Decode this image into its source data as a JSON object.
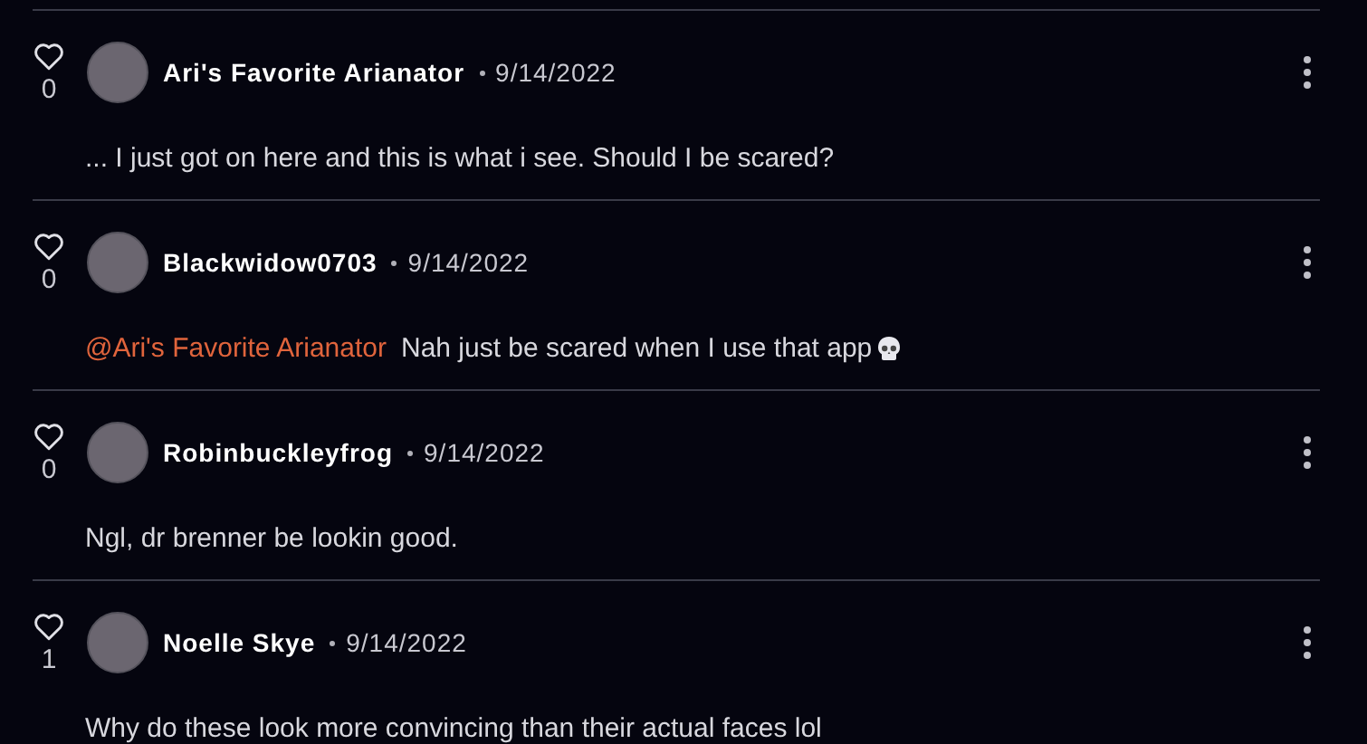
{
  "comments": [
    {
      "likes": "0",
      "liked": false,
      "author": "Ari's Favorite Arianator",
      "date": "9/14/2022",
      "text": "... I just got on here and this is what i see. Should I be scared?",
      "skull_emoji": false
    },
    {
      "likes": "0",
      "liked": false,
      "author": "Blackwidow0703",
      "date": "9/14/2022",
      "mention": "@Ari's Favorite Arianator",
      "text": "Nah just be scared when I use that app",
      "skull_emoji": true
    },
    {
      "likes": "0",
      "liked": false,
      "author": "Robinbuckleyfrog",
      "date": "9/14/2022",
      "text": "Ngl, dr brenner be lookin good.",
      "skull_emoji": false
    },
    {
      "likes": "1",
      "liked": false,
      "author": "Noelle Skye",
      "date": "9/14/2022",
      "text": "Why do these look more convincing than their actual faces lol",
      "skull_emoji": false
    }
  ]
}
